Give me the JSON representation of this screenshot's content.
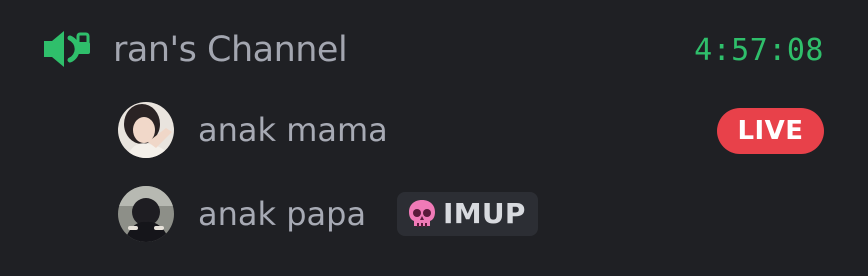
{
  "channel": {
    "name": "ran's Channel",
    "timer": "4:57:08",
    "icon": "voice-channel-speaker-icon",
    "accent_color": "#2fbf6b"
  },
  "users": [
    {
      "name": "anak mama",
      "avatar": "avatar-photo",
      "badge": {
        "label": "LIVE",
        "color": "#e8414a"
      }
    },
    {
      "name": "anak papa",
      "avatar": "avatar-photo",
      "activity": {
        "label": "IMUP",
        "icon": "skull-icon"
      }
    }
  ]
}
